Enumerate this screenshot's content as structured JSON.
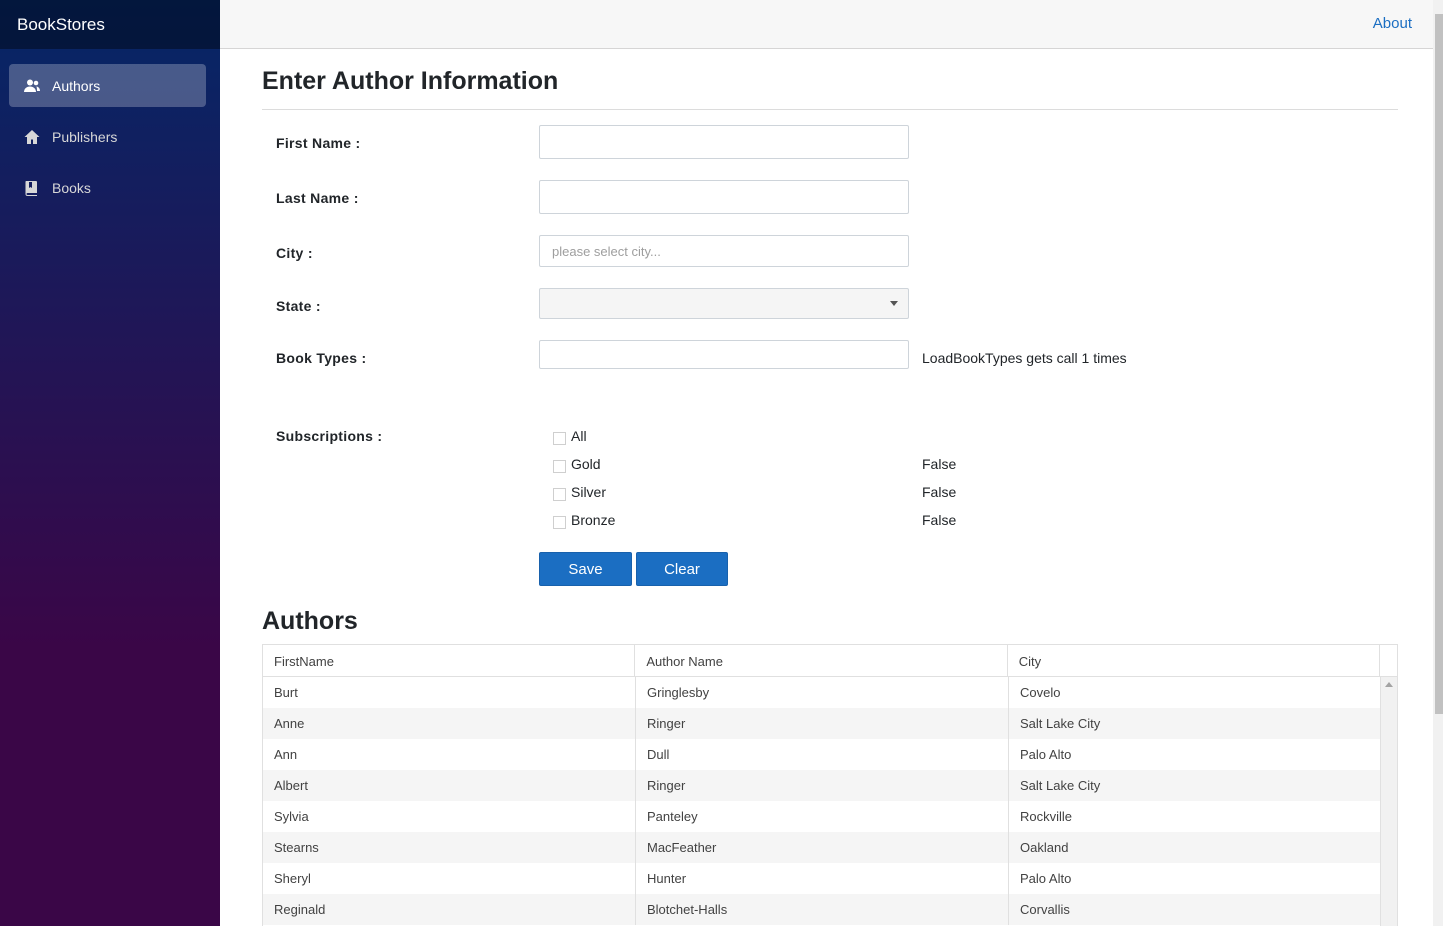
{
  "app": {
    "brand": "BookStores"
  },
  "sidebar": {
    "items": [
      {
        "label": "Authors",
        "icon": "people-icon",
        "active": true
      },
      {
        "label": "Publishers",
        "icon": "home-icon",
        "active": false
      },
      {
        "label": "Books",
        "icon": "book-icon",
        "active": false
      }
    ]
  },
  "topbar": {
    "about": "About"
  },
  "form": {
    "title": "Enter Author Information",
    "first_name_label": "First Name :",
    "first_name_value": "",
    "last_name_label": "Last Name :",
    "last_name_value": "",
    "city_label": "City :",
    "city_placeholder": "please select city...",
    "state_label": "State :",
    "state_value": "",
    "book_types_label": "Book Types :",
    "book_types_value": "",
    "book_types_note": "LoadBookTypes gets call 1 times",
    "subscriptions_label": "Subscriptions :",
    "subscriptions": [
      {
        "label": "All",
        "checked": false,
        "state": ""
      },
      {
        "label": "Gold",
        "checked": false,
        "state": "False"
      },
      {
        "label": "Silver",
        "checked": false,
        "state": "False"
      },
      {
        "label": "Bronze",
        "checked": false,
        "state": "False"
      }
    ],
    "save_label": "Save",
    "clear_label": "Clear"
  },
  "authors": {
    "title": "Authors",
    "columns": [
      "FirstName",
      "Author Name",
      "City"
    ],
    "rows": [
      [
        "Burt",
        "Gringlesby",
        "Covelo"
      ],
      [
        "Anne",
        "Ringer",
        "Salt Lake City"
      ],
      [
        "Ann",
        "Dull",
        "Palo Alto"
      ],
      [
        "Albert",
        "Ringer",
        "Salt Lake City"
      ],
      [
        "Sylvia",
        "Panteley",
        "Rockville"
      ],
      [
        "Stearns",
        "MacFeather",
        "Oakland"
      ],
      [
        "Sheryl",
        "Hunter",
        "Palo Alto"
      ],
      [
        "Reginald",
        "Blotchet-Halls",
        "Corvallis"
      ]
    ]
  },
  "colors": {
    "sidebar_top": "#052767",
    "sidebar_bottom": "#3a0647",
    "accent": "#1b6ec2"
  }
}
